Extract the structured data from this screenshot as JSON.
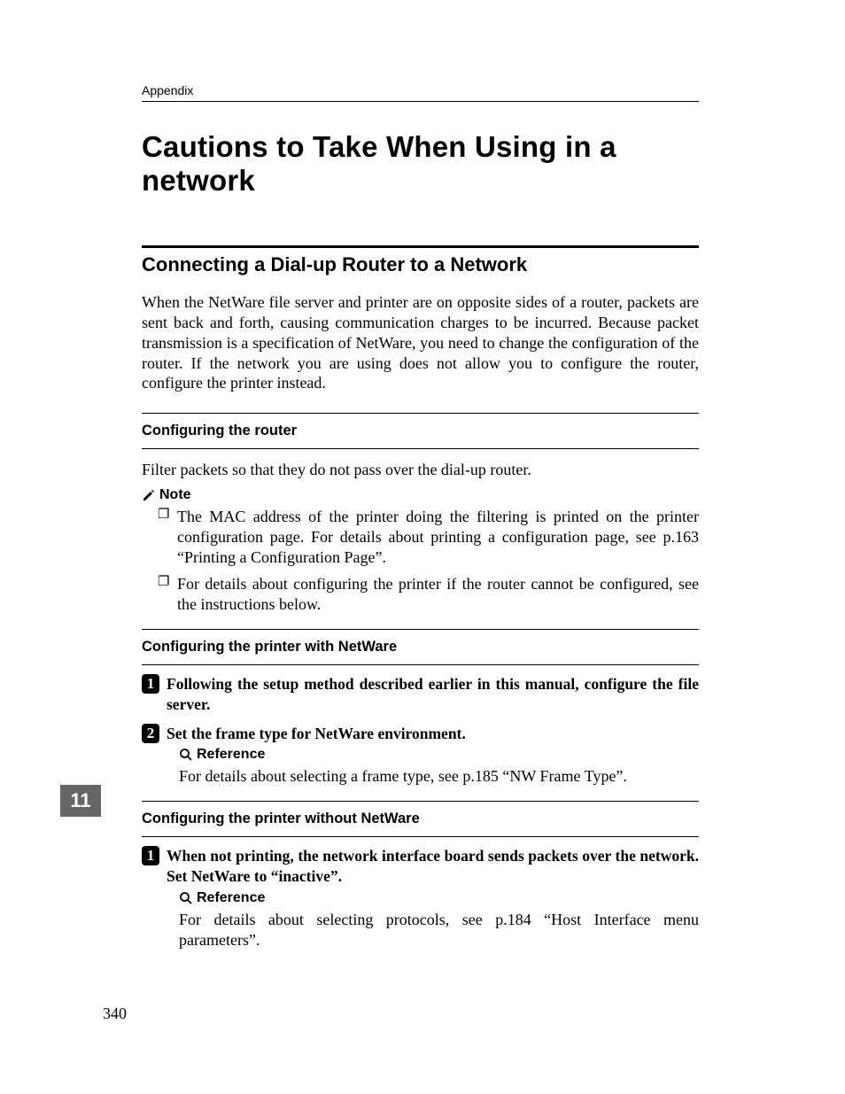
{
  "header": {
    "section": "Appendix"
  },
  "title": "Cautions to Take When Using in a network",
  "h2": "Connecting a Dial-up Router to a Network",
  "intro": "When the NetWare file server and printer are on opposite sides of a router, packets are sent back and forth, causing communication charges to be incurred. Because packet transmission is a specification of NetWare, you need to change the configuration of the router. If the network you are using does not allow you to configure the router, configure the printer instead.",
  "sec_router": {
    "heading": "Configuring the router",
    "body": "Filter packets so that they do not pass over the dial-up router.",
    "note_label": "Note",
    "notes": [
      "The MAC address of the printer doing the filtering is printed on the printer configuration page. For details about printing a configuration page, see p.163 “Printing a Configuration Page”.",
      "For details about configuring the printer if the router cannot be configured, see the instructions below."
    ]
  },
  "sec_with": {
    "heading": "Configuring the printer with NetWare",
    "step1_num": "1",
    "step1": "Following the setup method described earlier in this manual, configure the file server.",
    "step2_num": "2",
    "step2": "Set the frame type for NetWare environment.",
    "ref_label": "Reference",
    "ref_body": "For details about selecting a frame type, see p.185 “NW Frame Type”."
  },
  "sec_without": {
    "heading": "Configuring the printer without NetWare",
    "step1_num": "1",
    "step1": "When not printing, the network interface board sends packets over the network. Set NetWare to “inactive”.",
    "ref_label": "Reference",
    "ref_body": "For details about selecting protocols, see p.184 “Host Interface menu parameters”."
  },
  "chapter_tab": "11",
  "page_number": "340"
}
